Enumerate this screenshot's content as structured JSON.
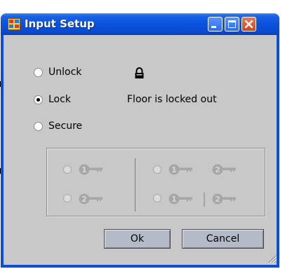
{
  "window": {
    "title": "Input Setup",
    "app_icon": "window-app-icon",
    "controls": {
      "minimize": "minimize-icon",
      "maximize": "maximize-icon",
      "close": "close-icon"
    }
  },
  "mode": {
    "options": [
      {
        "label": "Unlock",
        "selected": false
      },
      {
        "label": "Lock",
        "selected": true
      },
      {
        "label": "Secure",
        "selected": false
      }
    ],
    "status_icon": "lock-icon",
    "status_text": "Floor is locked out"
  },
  "key_options": {
    "disabled": true,
    "left": [
      {
        "keys": [
          "1"
        ],
        "selected": false
      },
      {
        "keys": [
          "2"
        ],
        "selected": false
      }
    ],
    "right": [
      {
        "keys": [
          "1",
          "2"
        ],
        "separator": "",
        "selected": false
      },
      {
        "keys": [
          "1",
          "2"
        ],
        "separator": "|",
        "selected": false
      }
    ]
  },
  "buttons": {
    "ok": "Ok",
    "cancel": "Cancel"
  },
  "colors": {
    "title_bar": "#0a52dc",
    "client": "#c8c8c8",
    "button": "#b4bac8",
    "close": "#c94521"
  }
}
